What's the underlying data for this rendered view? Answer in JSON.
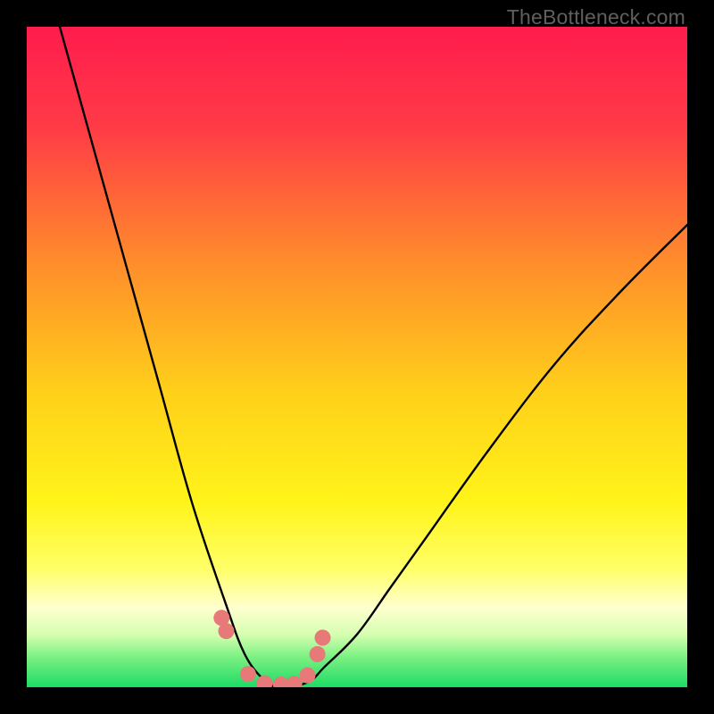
{
  "watermark": "TheBottleneck.com",
  "chart_data": {
    "type": "line",
    "title": "",
    "xlabel": "",
    "ylabel": "",
    "xlim": [
      0,
      100
    ],
    "ylim": [
      0,
      100
    ],
    "series": [
      {
        "name": "bottleneck-curve",
        "x": [
          5,
          10,
          15,
          20,
          25,
          30,
          33,
          36,
          38,
          40,
          43,
          45,
          50,
          55,
          60,
          70,
          80,
          90,
          100
        ],
        "y": [
          100,
          82,
          64,
          46,
          28,
          13,
          5,
          1,
          0,
          0,
          1,
          3,
          8,
          15,
          22,
          36,
          49,
          60,
          70
        ]
      }
    ],
    "markers": {
      "name": "highlight-points",
      "color": "#e77a78",
      "x": [
        29.5,
        30.2,
        33.5,
        36,
        38.5,
        40.5,
        42.5,
        44.0,
        44.8
      ],
      "y": [
        10.5,
        8.5,
        2.0,
        0.6,
        0.4,
        0.5,
        1.8,
        5.0,
        7.5
      ]
    },
    "gradient_stops": [
      {
        "pos": 0.0,
        "color": "#ff1c4e"
      },
      {
        "pos": 0.15,
        "color": "#ff3a46"
      },
      {
        "pos": 0.35,
        "color": "#ff8a2c"
      },
      {
        "pos": 0.55,
        "color": "#ffcf1a"
      },
      {
        "pos": 0.72,
        "color": "#fff41a"
      },
      {
        "pos": 0.82,
        "color": "#ffff66"
      },
      {
        "pos": 0.88,
        "color": "#ffffd0"
      },
      {
        "pos": 0.92,
        "color": "#d6ffb0"
      },
      {
        "pos": 0.955,
        "color": "#7af082"
      },
      {
        "pos": 1.0,
        "color": "#1ddb66"
      }
    ]
  }
}
